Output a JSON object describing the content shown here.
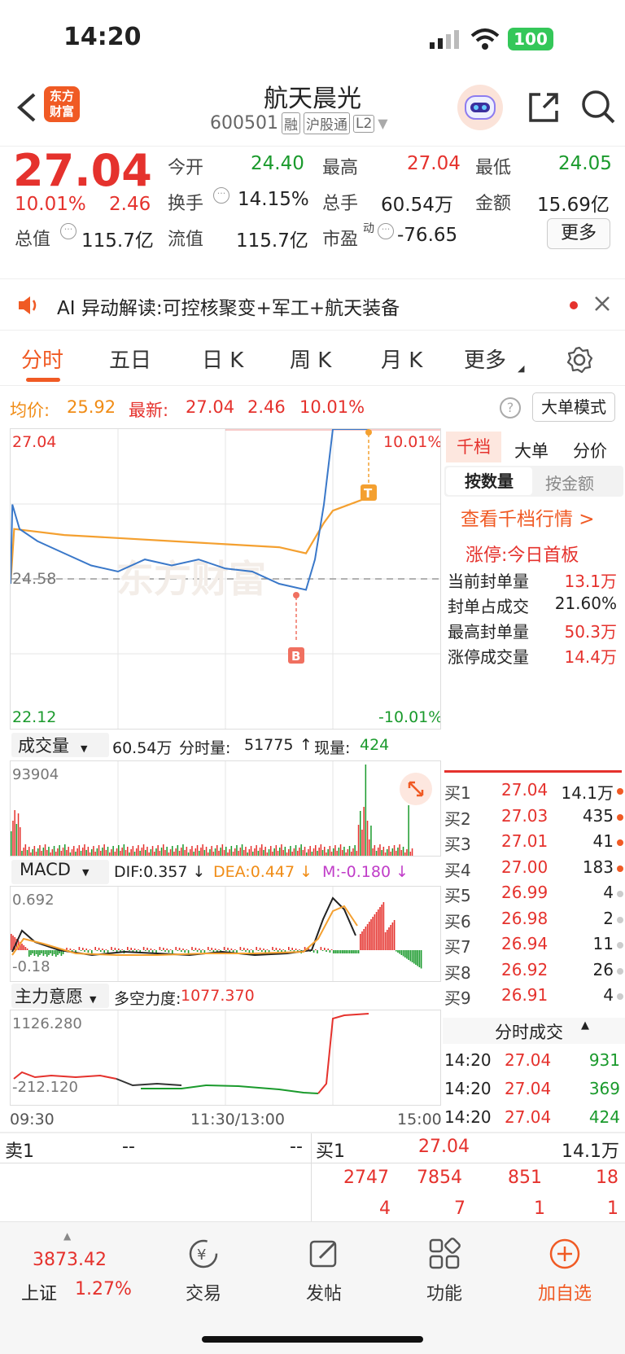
{
  "status": {
    "time": "14:20",
    "battery": "100"
  },
  "header": {
    "title": "航天晨光",
    "code": "600501",
    "tag_rong": "融",
    "tag_hgt": "沪股通",
    "tag_l2": "L2",
    "app_logo_line1": "东方",
    "app_logo_line2": "财富"
  },
  "quote": {
    "price": "27.04",
    "pct": "10.01%",
    "change": "2.46",
    "open_label": "今开",
    "open": "24.40",
    "high_label": "最高",
    "high": "27.04",
    "low_label": "最低",
    "low": "24.05",
    "turnover_label": "换手",
    "turnover": "14.15%",
    "volume_label": "总手",
    "volume": "60.54万",
    "amount_label": "金额",
    "amount": "15.69亿",
    "mktcap_label": "总值",
    "mktcap": "115.7亿",
    "float_label": "流值",
    "float": "115.7亿",
    "pe_label": "市盈",
    "pe_sup": "动",
    "pe": "-76.65",
    "more_button": "更多"
  },
  "ai": {
    "text": "AI 异动解读:可控核聚变+军工+航天装备"
  },
  "tabs": [
    "分时",
    "五日",
    "日 K",
    "周 K",
    "月 K",
    "更多"
  ],
  "info_row": {
    "avg_label": "均价:",
    "avg": "25.92",
    "latest_label": "最新:",
    "latest": "27.04",
    "latest_chg": "2.46",
    "latest_pct": "10.01%",
    "mode_button": "大单模式"
  },
  "main_chart": {
    "top_price": "27.04",
    "top_pct": "10.01%",
    "mid_price": "24.58",
    "bottom_price": "22.12",
    "bottom_pct": "-10.01%",
    "watermark": "东方财富",
    "marker_b": "B",
    "marker_t": "T"
  },
  "chart_data": {
    "type": "line",
    "title": "",
    "ylim": [
      22.12,
      27.04
    ],
    "series": [
      {
        "name": "最新",
        "x": [
          "09:30",
          "09:31",
          "09:35",
          "09:45",
          "10:00",
          "10:15",
          "10:30",
          "10:45",
          "11:00",
          "11:15",
          "11:30",
          "13:15",
          "13:30",
          "13:45",
          "13:50",
          "13:55",
          "14:00",
          "14:05",
          "14:10",
          "14:20"
        ],
        "values": [
          24.5,
          25.8,
          25.4,
          25.2,
          25.0,
          24.8,
          24.7,
          24.9,
          24.8,
          24.9,
          24.75,
          24.7,
          24.5,
          24.4,
          24.9,
          25.8,
          27.04,
          27.04,
          27.04,
          27.04
        ]
      },
      {
        "name": "均价",
        "x": [
          "09:30",
          "09:32",
          "10:00",
          "11:00",
          "11:30",
          "13:30",
          "13:45",
          "13:55",
          "14:00",
          "14:20"
        ],
        "values": [
          24.5,
          25.4,
          25.3,
          25.2,
          25.15,
          25.1,
          25.0,
          25.5,
          25.7,
          25.92
        ]
      }
    ]
  },
  "volume": {
    "label": "成交量",
    "total": "60.54万",
    "minute_label": "分时量:",
    "minute": "51775",
    "current_label": "现量:",
    "current": "424",
    "max": "93904"
  },
  "macd": {
    "label": "MACD",
    "dif": "DIF:0.357",
    "dea": "DEA:0.447",
    "m": "M:-0.180",
    "top": "0.692",
    "bottom": "-0.18"
  },
  "flow": {
    "label": "主力意愿",
    "strength_label": "多空力度:",
    "strength": "1077.370",
    "top": "1126.280",
    "bottom": "-212.120"
  },
  "time_axis": [
    "09:30",
    "11:30/13:00",
    "15:00"
  ],
  "side": {
    "tabs": [
      "千档",
      "大单",
      "分价"
    ],
    "subtabs": [
      "按数量",
      "按金额"
    ],
    "link": "查看千档行情 >",
    "limit_title": "涨停:今日首板",
    "stats": [
      {
        "label": "当前封单量",
        "value": "13.1万"
      },
      {
        "label": "封单占成交",
        "value": "21.60%"
      },
      {
        "label": "最高封单量",
        "value": "50.3万"
      },
      {
        "label": "涨停成交量",
        "value": "14.4万"
      }
    ],
    "buys": [
      {
        "label": "买1",
        "price": "27.04",
        "vol": "14.1万"
      },
      {
        "label": "买2",
        "price": "27.03",
        "vol": "435"
      },
      {
        "label": "买3",
        "price": "27.01",
        "vol": "41"
      },
      {
        "label": "买4",
        "price": "27.00",
        "vol": "183"
      },
      {
        "label": "买5",
        "price": "26.99",
        "vol": "4"
      },
      {
        "label": "买6",
        "price": "26.98",
        "vol": "2"
      },
      {
        "label": "买7",
        "price": "26.94",
        "vol": "11"
      },
      {
        "label": "买8",
        "price": "26.92",
        "vol": "26"
      },
      {
        "label": "买9",
        "price": "26.91",
        "vol": "4"
      }
    ],
    "ticks_title": "分时成交",
    "ticks": [
      {
        "time": "14:20",
        "price": "27.04",
        "vol": "931"
      },
      {
        "time": "14:20",
        "price": "27.04",
        "vol": "369"
      },
      {
        "time": "14:20",
        "price": "27.04",
        "vol": "424"
      }
    ]
  },
  "orderbook": {
    "sell_label": "卖1",
    "sell_price": "--",
    "sell_vol": "--",
    "buy_label": "买1",
    "buy_price": "27.04",
    "buy_vol": "14.1万",
    "row2": [
      "2747",
      "7854",
      "851",
      "18"
    ],
    "row3": [
      "4",
      "7",
      "1",
      "1"
    ]
  },
  "bottomnav": {
    "index_value": "3873.42",
    "index_name": "上证",
    "index_pct": "1.27%",
    "items": [
      "交易",
      "发帖",
      "功能",
      "加自选"
    ]
  }
}
